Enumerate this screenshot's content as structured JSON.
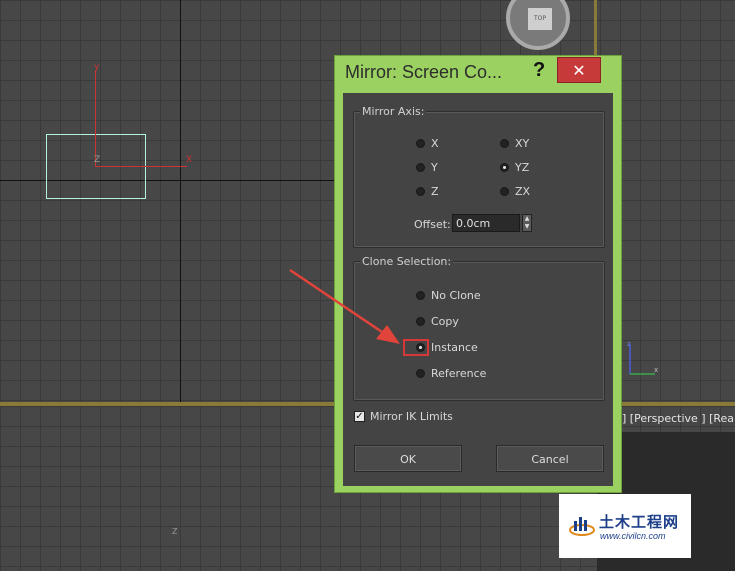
{
  "viewport": {
    "viewcube_label": "TOP",
    "perspective_label": "] [Perspective ] [Realist",
    "gizmo_x": "X",
    "gizmo_y": "Y",
    "gizmo_z": "Z",
    "bottom_z": "Z"
  },
  "dialog": {
    "title": "Mirror: Screen Co...",
    "help_label": "?",
    "close_label": "✕",
    "mirror_axis": {
      "title": "Mirror Axis:",
      "options": [
        "X",
        "Y",
        "Z",
        "XY",
        "YZ",
        "ZX"
      ],
      "selected": "YZ",
      "offset_label": "Offset:",
      "offset_value": "0.0cm"
    },
    "clone_selection": {
      "title": "Clone Selection:",
      "options": [
        "No Clone",
        "Copy",
        "Instance",
        "Reference"
      ],
      "selected": "Instance"
    },
    "mirror_ik": {
      "label": "Mirror IK Limits",
      "checked": true
    },
    "ok_label": "OK",
    "cancel_label": "Cancel"
  },
  "watermark": {
    "title": "土木工程网",
    "url": "www.civilcn.com"
  },
  "colors": {
    "dialog_frame": "#9ad160",
    "close_button": "#c73a3a",
    "highlight": "#d6383a",
    "arrow": "#e0443a",
    "selection_box": "#b4f0e0",
    "gizmo": "#cc3333"
  }
}
